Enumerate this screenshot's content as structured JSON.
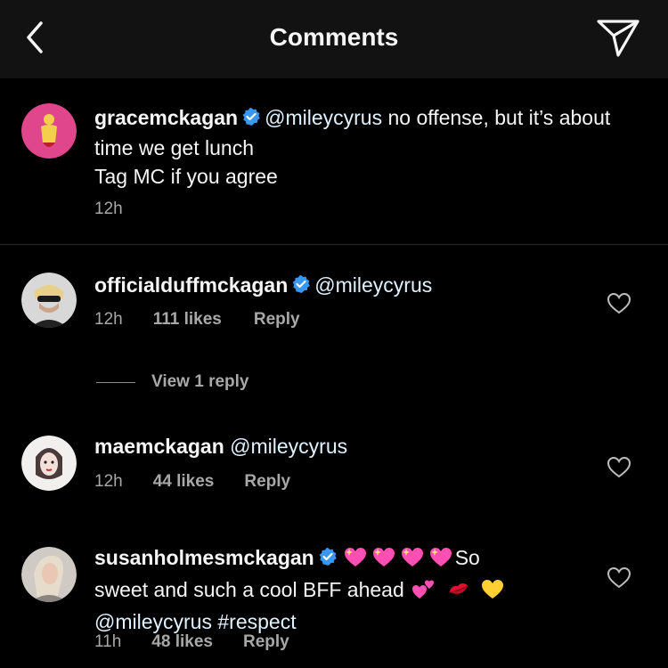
{
  "header": {
    "title": "Comments"
  },
  "caption": {
    "username": "gracemckagan",
    "mention": "@mileycyrus",
    "text": " no offense, but it’s about time we get lunch",
    "text2": "Tag MC if you agree",
    "time": "12h"
  },
  "comments": [
    {
      "username": "officialduffmckagan",
      "mention": "@mileycyrus",
      "time": "12h",
      "likes": "111 likes",
      "reply": "Reply",
      "view_replies": "View 1 reply"
    },
    {
      "username": "maemckagan",
      "mention": "@mileycyrus",
      "time": "12h",
      "likes": "44 likes",
      "reply": "Reply"
    },
    {
      "username": "susanholmesmckagan",
      "text_after_emojis": "So",
      "text_line2": "sweet and such a cool BFF ahead",
      "mention": "@mileycyrus",
      "hashtag": "#respect",
      "time": "11h",
      "likes": "48 likes",
      "reply": "Reply"
    }
  ],
  "colors": {
    "verified": "#3897f0",
    "meta": "#a8a8a8",
    "header_bg": "#121212"
  }
}
